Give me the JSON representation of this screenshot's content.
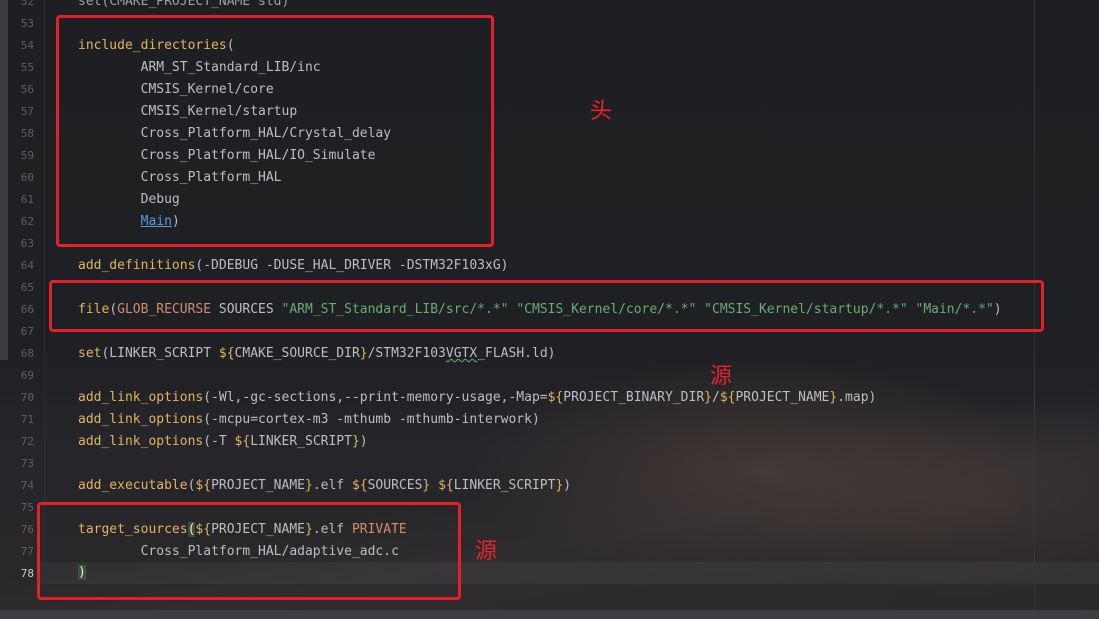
{
  "editor": {
    "line_numbers": [
      "52",
      "53",
      "54",
      "55",
      "56",
      "57",
      "58",
      "59",
      "60",
      "61",
      "62",
      "63",
      "64",
      "65",
      "66",
      "67",
      "68",
      "69",
      "70",
      "71",
      "72",
      "73",
      "74",
      "75",
      "76",
      "77",
      "78"
    ],
    "lines": {
      "l52": "set(CMAKE_PROJECT_NAME std)",
      "l54_fn": "include_directories",
      "l54_rest": "(",
      "l55": "ARM_ST_Standard_LIB/inc",
      "l56": "CMSIS_Kernel/core",
      "l57": "CMSIS_Kernel/startup",
      "l58": "Cross_Platform_HAL/Crystal_delay",
      "l59": "Cross_Platform_HAL/IO_Simulate",
      "l60": "Cross_Platform_HAL",
      "l61": "Debug",
      "l62_link": "Main",
      "l62_rest": ")",
      "l64_fn": "add_definitions",
      "l64_rest": "(-DDEBUG -DUSE_HAL_DRIVER -DSTM32F103xG)",
      "l66_fn": "file",
      "l66_p": "(",
      "l66_kw": "GLOB_RECURSE",
      "l66_mid": " SOURCES ",
      "l66_s1": "\"ARM_ST_Standard_LIB/src/*.*\"",
      "l66_s2": "\"CMSIS_Kernel/core/*.*\"",
      "l66_s3": "\"CMSIS_Kernel/startup/*.*\"",
      "l66_s4": "\"Main/*.*\"",
      "l66_end": ")",
      "l68_fn": "set",
      "l68_a": "(LINKER_SCRIPT ",
      "l68_var": "${",
      "l68_b": "CMAKE_SOURCE_DIR",
      "l68_var2": "}",
      "l68_c": "/STM32F103",
      "l68_sq": "VGTX",
      "l68_d": "_FLASH.ld)",
      "l70_fn": "add_link_options",
      "l70_a": "(-Wl,-gc-sections,--print-memory-usage,-Map=",
      "l70_v1": "${",
      "l70_b": "PROJECT_BINARY_DIR",
      "l70_v2": "}",
      "l70_c": "/",
      "l70_v3": "${",
      "l70_d": "PROJECT_NAME",
      "l70_v4": "}",
      "l70_e": ".map)",
      "l71_fn": "add_link_options",
      "l71_rest": "(-mcpu=cortex-m3 -mthumb -mthumb-interwork)",
      "l72_fn": "add_link_options",
      "l72_a": "(-T ",
      "l72_v1": "${",
      "l72_b": "LINKER_SCRIPT",
      "l72_v2": "}",
      "l72_c": ")",
      "l74_fn": "add_executable",
      "l74_a": "(",
      "l74_v1": "${",
      "l74_b": "PROJECT_NAME",
      "l74_v2": "}",
      "l74_c": ".elf ",
      "l74_v3": "${",
      "l74_d": "SOURCES",
      "l74_v4": "}",
      "l74_e": " ",
      "l74_v5": "${",
      "l74_f": "LINKER_SCRIPT",
      "l74_v6": "}",
      "l74_g": ")",
      "l76_fn": "target_sources",
      "l76_br": "(",
      "l76_v1": "${",
      "l76_b": "PROJECT_NAME",
      "l76_v2": "}",
      "l76_c": ".elf ",
      "l76_kw": "PRIVATE",
      "l77": "Cross_Platform_HAL/adaptive_adc.c",
      "l78": ")"
    }
  },
  "annotations": {
    "note_header": "头",
    "note_source_1": "源",
    "note_source_2": "源"
  },
  "colors": {
    "annotation_red": "#e5202a",
    "function_yellow": "#e0b460",
    "string_green": "#6aab73",
    "keyword_orange": "#cf8e6d"
  }
}
